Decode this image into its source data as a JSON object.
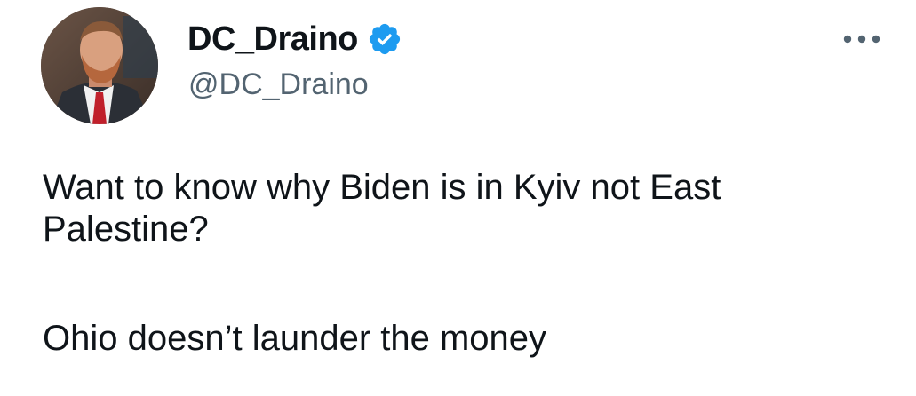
{
  "author": {
    "display_name": "DC_Draino",
    "handle": "@DC_Draino",
    "verified": true,
    "avatar_icon": "profile-photo"
  },
  "tweet": {
    "paragraph_1": "Want to know why Biden is in Kyiv not East\nPalestine?",
    "paragraph_2": "Ohio doesn’t launder the money"
  },
  "menu": {
    "icon": "more-horizontal-icon"
  },
  "colors": {
    "text_primary": "#0f1419",
    "text_secondary": "#536471",
    "verified_blue": "#1d9bf0",
    "background": "#ffffff"
  }
}
